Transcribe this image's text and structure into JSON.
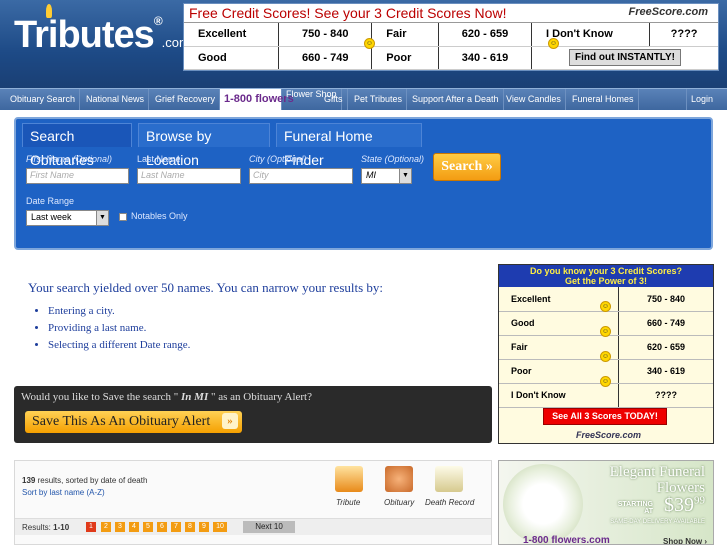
{
  "header": {
    "logo_text": "Tributes",
    "logo_suffix": ".com",
    "logo_reg": "®"
  },
  "top_ad": {
    "title": "Free Credit Scores! See your 3 Credit Scores Now!",
    "brand": "FreeScore.com",
    "rows": [
      {
        "a_label": "Excellent",
        "a_value": "750 - 840",
        "b_label": "Fair",
        "b_value": "620 - 659",
        "c_label": "I Don't Know",
        "c_value": "????"
      },
      {
        "a_label": "Good",
        "a_value": "660 - 749",
        "b_label": "Poor",
        "b_value": "340 - 619",
        "c_label": "Find out INSTANTLY!"
      }
    ]
  },
  "nav": {
    "items": [
      "Obituary Search",
      "National News",
      "Grief Recovery",
      "1-800 flowers",
      "Flower Shop",
      "Gifts",
      "Pet Tributes",
      "Support After a Death",
      "View Candles",
      "Funeral Homes"
    ],
    "login": "Login"
  },
  "search": {
    "tabs": [
      "Search Obituaries",
      "Browse by Location",
      "Funeral Home Finder"
    ],
    "first_name_label": "First Name (Optional)",
    "first_name_placeholder": "First Name",
    "last_name_label": "Last Name",
    "last_name_placeholder": "Last Name",
    "city_label": "City (Optional)",
    "city_placeholder": "City",
    "state_label": "State (Optional)",
    "state_value": "MI",
    "search_button": "Search »",
    "date_range_label": "Date Range",
    "date_range_value": "Last week",
    "notables_label": "Notables Only"
  },
  "results_message": {
    "headline": "Your search yielded over 50 names. You can narrow your results by:",
    "bullets": [
      "Entering a city.",
      "Providing a last name.",
      "Selecting a different Date range."
    ]
  },
  "alert": {
    "prefix": "Would you like to Save the search \"",
    "query": " In MI ",
    "suffix": "\" as an Obituary Alert?",
    "button": "Save This As An Obituary Alert",
    "button_arrow": "»"
  },
  "side_ad": {
    "header_line1": "Do you know your 3 Credit Scores?",
    "header_line2": "Get the Power of 3!",
    "rows": [
      {
        "label": "Excellent",
        "value": "750 - 840"
      },
      {
        "label": "Good",
        "value": "660 - 749"
      },
      {
        "label": "Fair",
        "value": "620 - 659"
      },
      {
        "label": "Poor",
        "value": "340 - 619"
      },
      {
        "label": "I Don't Know",
        "value": "????"
      }
    ],
    "button": "See All 3 Scores TODAY!",
    "brand": "FreeScore.com"
  },
  "results": {
    "count": "139",
    "count_suffix": " results, sorted by date of death",
    "sort_link": "Sort by last name (A-Z)",
    "views": [
      "Tribute",
      "Obituary",
      "Death Record"
    ],
    "range_label": "Results:",
    "range": "1-10",
    "pages": [
      "1",
      "2",
      "3",
      "4",
      "5",
      "6",
      "7",
      "8",
      "9",
      "10"
    ],
    "next": "Next 10"
  },
  "flower_ad": {
    "title_line1": "Elegant Funeral",
    "title_line2": "Flowers",
    "starting_line1": "STARTING",
    "starting_line2": "AT",
    "price": "$39",
    "price_cents": "99",
    "delivery": "SAME-DAY DELIVERY AVAILABLE",
    "brand": "1-800 flowers.com",
    "shop": "Shop Now ›"
  }
}
